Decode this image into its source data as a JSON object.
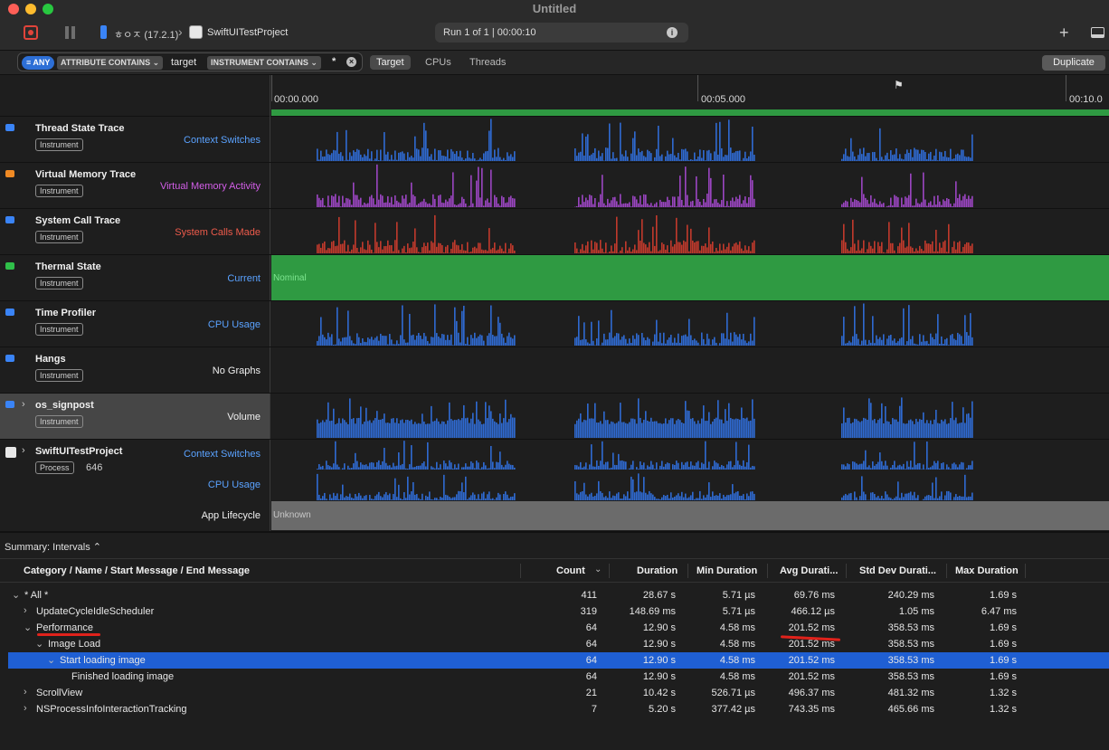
{
  "window": {
    "title": "Untitled"
  },
  "toolbar": {
    "device": "ㅎㅇㅈ (17.2.1)",
    "app": "SwiftUITestProject",
    "run_status": "Run 1 of 1  |  00:00:10",
    "add_label": "+"
  },
  "filter": {
    "any_label": "≡ ANY",
    "attribute_pill": "ATTRIBUTE CONTAINS ⌄",
    "attribute_value": "target",
    "instrument_pill": "INSTRUMENT CONTAINS ⌄",
    "instrument_value": "*",
    "tabs": [
      "Target",
      "CPUs",
      "Threads"
    ],
    "duplicate_label": "Duplicate"
  },
  "ruler": {
    "ticks": [
      "00:00.000",
      "00:05.000",
      "00:10.0"
    ]
  },
  "tracks": [
    {
      "title": "Thread State Trace",
      "badge": "Instrument",
      "graph_label": "Context Switches",
      "label_color": "#5aa2ff",
      "series_color": "#2f6ad2",
      "icon_color": "#3a84f7"
    },
    {
      "title": "Virtual Memory Trace",
      "badge": "Instrument",
      "graph_label": "Virtual Memory Activity",
      "label_color": "#d35ee8",
      "series_color": "#9b45c2",
      "icon_color": "#f08a24"
    },
    {
      "title": "System Call Trace",
      "badge": "Instrument",
      "graph_label": "System Calls Made",
      "label_color": "#ee5b4b",
      "series_color": "#c23a2c",
      "icon_color": "#3a84f7"
    },
    {
      "title": "Thermal State",
      "badge": "Instrument",
      "graph_label": "Current",
      "label_color": "#5aa2ff",
      "fill_text": "Nominal",
      "icon_color": "#2fbf49"
    },
    {
      "title": "Time Profiler",
      "badge": "Instrument",
      "graph_label": "CPU Usage",
      "label_color": "#5aa2ff",
      "series_color": "#2f6ad2",
      "icon_color": "#3a84f7"
    },
    {
      "title": "Hangs",
      "badge": "Instrument",
      "graph_label": "No Graphs",
      "label_color": "#f0f0f0",
      "icon_color": "#3a84f7"
    },
    {
      "title": "os_signpost",
      "badge": "Instrument",
      "graph_label": "Volume",
      "label_color": "#f0f0f0",
      "series_color": "#2f6ad2",
      "icon_color": "#3a84f7"
    }
  ],
  "process_track": {
    "title": "SwiftUITestProject",
    "badge": "Process",
    "pid": "646",
    "sub_labels": [
      "Context Switches",
      "CPU Usage",
      "App Lifecycle"
    ],
    "lifecycle_text": "Unknown"
  },
  "summary": {
    "label": "Summary: Intervals ⌃"
  },
  "table": {
    "columns": [
      "Category / Name / Start Message / End Message",
      "Count",
      "Duration",
      "Min Duration",
      "Avg Durati...",
      "Std Dev Durati...",
      "Max Duration"
    ],
    "rows": [
      {
        "name": "* All *",
        "indent": 0,
        "disc": "⌄",
        "count": "411",
        "duration": "28.67 s",
        "min": "5.71 µs",
        "avg": "69.76 ms",
        "std": "240.29 ms",
        "max": "1.69 s"
      },
      {
        "name": "UpdateCycleIdleScheduler",
        "indent": 1,
        "disc": "›",
        "count": "319",
        "duration": "148.69 ms",
        "min": "5.71 µs",
        "avg": "466.12 µs",
        "std": "1.05 ms",
        "max": "6.47 ms"
      },
      {
        "name": "Performance",
        "indent": 1,
        "disc": "⌄",
        "count": "64",
        "duration": "12.90 s",
        "min": "4.58 ms",
        "avg": "201.52 ms",
        "std": "358.53 ms",
        "max": "1.69 s"
      },
      {
        "name": "Image Load",
        "indent": 2,
        "disc": "⌄",
        "count": "64",
        "duration": "12.90 s",
        "min": "4.58 ms",
        "avg": "201.52 ms",
        "std": "358.53 ms",
        "max": "1.69 s"
      },
      {
        "name": "Start loading image",
        "indent": 3,
        "disc": "⌄",
        "count": "64",
        "duration": "12.90 s",
        "min": "4.58 ms",
        "avg": "201.52 ms",
        "std": "358.53 ms",
        "max": "1.69 s"
      },
      {
        "name": "Finished loading image",
        "indent": 4,
        "disc": "",
        "count": "64",
        "duration": "12.90 s",
        "min": "4.58 ms",
        "avg": "201.52 ms",
        "std": "358.53 ms",
        "max": "1.69 s"
      },
      {
        "name": "ScrollView",
        "indent": 1,
        "disc": "›",
        "count": "21",
        "duration": "10.42 s",
        "min": "526.71 µs",
        "avg": "496.37 ms",
        "std": "481.32 ms",
        "max": "1.32 s"
      },
      {
        "name": "NSProcessInfoInteractionTracking",
        "indent": 1,
        "disc": "›",
        "count": "7",
        "duration": "5.20 s",
        "min": "377.42 µs",
        "avg": "743.35 ms",
        "std": "465.66 ms",
        "max": "1.32 s"
      }
    ]
  }
}
